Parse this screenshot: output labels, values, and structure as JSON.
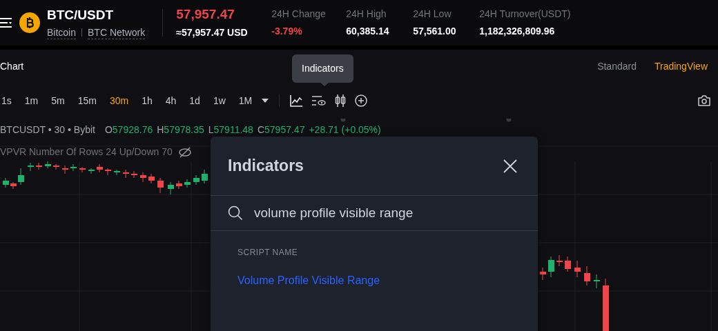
{
  "header": {
    "pair": "BTC/USDT",
    "coin_name": "Bitcoin",
    "network": "BTC Network",
    "price": "57,957.47",
    "price_usd": "≈57,957.47 USD",
    "stats": [
      {
        "label": "24H Change",
        "value": "-3.79%",
        "kind": "change"
      },
      {
        "label": "24H High",
        "value": "60,385.14",
        "kind": "plain"
      },
      {
        "label": "24H Low",
        "value": "57,561.00",
        "kind": "plain"
      },
      {
        "label": "24H Turnover(USDT)",
        "value": "1,182,326,809.96",
        "kind": "plain"
      }
    ]
  },
  "chart_title": "Chart",
  "view_modes": [
    {
      "label": "Standard",
      "selected": false
    },
    {
      "label": "TradingView",
      "selected": true
    }
  ],
  "tooltip": "Indicators",
  "intervals": [
    {
      "label": "1s",
      "selected": false
    },
    {
      "label": "1m",
      "selected": false
    },
    {
      "label": "5m",
      "selected": false
    },
    {
      "label": "15m",
      "selected": false
    },
    {
      "label": "30m",
      "selected": true
    },
    {
      "label": "1h",
      "selected": false
    },
    {
      "label": "4h",
      "selected": false
    },
    {
      "label": "1d",
      "selected": false
    },
    {
      "label": "1w",
      "selected": false
    },
    {
      "label": "1M",
      "selected": false
    }
  ],
  "legend": {
    "symbol": "BTCUSDT • 30 • Bybit",
    "ohlc": [
      {
        "key": "O",
        "value": "57928.76"
      },
      {
        "key": "H",
        "value": "57978.35"
      },
      {
        "key": "L",
        "value": "57911.48"
      },
      {
        "key": "C",
        "value": "57957.47"
      }
    ],
    "change": "+28.71 (+0.05%)"
  },
  "indicator_legend": "VPVR Number Of Rows 24 Up/Down 70",
  "modal": {
    "title": "Indicators",
    "search": "volume profile visible range",
    "section": "SCRIPT NAME",
    "results": [
      "Volume Profile Visible Range"
    ]
  }
}
